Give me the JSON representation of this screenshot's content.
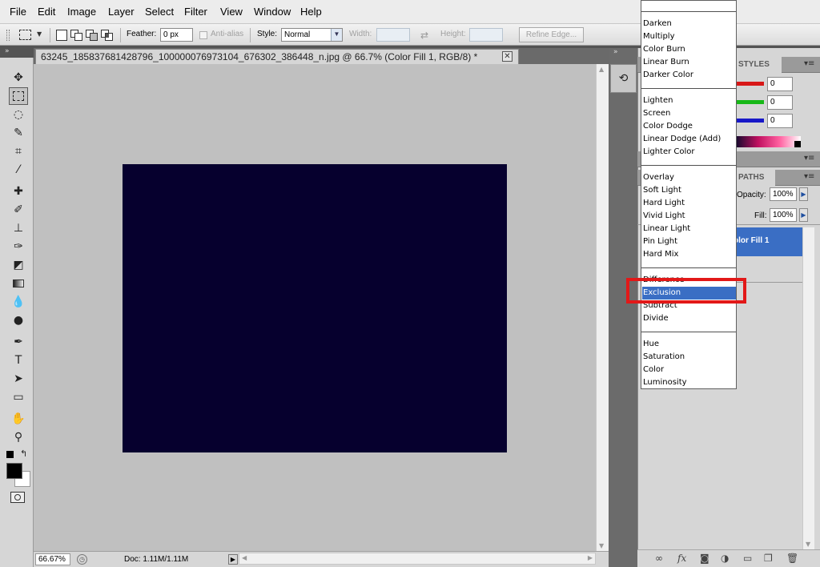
{
  "menubar": {
    "items": [
      "File",
      "Edit",
      "Image",
      "Layer",
      "Select",
      "Filter",
      "View",
      "Window",
      "Help"
    ]
  },
  "options": {
    "feather_label": "Feather:",
    "feather_value": "0 px",
    "antialias_label": "Anti-alias",
    "style_label": "Style:",
    "style_value": "Normal",
    "width_label": "Width:",
    "height_label": "Height:",
    "refine_edge_label": "Refine Edge..."
  },
  "document": {
    "tab_title": "63245_185837681428796_100000076973104_676302_386448_n.jpg @ 66.7% (Color Fill 1, RGB/8) *",
    "close_glyph": "✕",
    "canvas_color": "#06002e"
  },
  "statusbar": {
    "zoom": "66.67%",
    "doc_info": "Doc: 1.11M/1.11M"
  },
  "panels": {
    "styles_tab": "STYLES",
    "paths_tab": "PATHS",
    "color_values": [
      "0",
      "0",
      "0"
    ],
    "opacity_label": "Opacity:",
    "opacity_value": "100%",
    "fill_label": "Fill:",
    "fill_value": "100%",
    "layer_name": "olor Fill 1"
  },
  "blend_modes": {
    "groups": [
      [
        "Darken",
        "Multiply",
        "Color Burn",
        "Linear Burn",
        "Darker Color"
      ],
      [
        "Lighten",
        "Screen",
        "Color Dodge",
        "Linear Dodge (Add)",
        "Lighter Color"
      ],
      [
        "Overlay",
        "Soft Light",
        "Hard Light",
        "Vivid Light",
        "Linear Light",
        "Pin Light",
        "Hard Mix"
      ],
      [
        "Difference",
        "Exclusion",
        "Subtract",
        "Divide"
      ],
      [
        "Hue",
        "Saturation",
        "Color",
        "Luminosity"
      ]
    ],
    "selected": "Exclusion"
  },
  "colors": {
    "highlight": "#e21818",
    "selection": "#3a6ec4"
  }
}
